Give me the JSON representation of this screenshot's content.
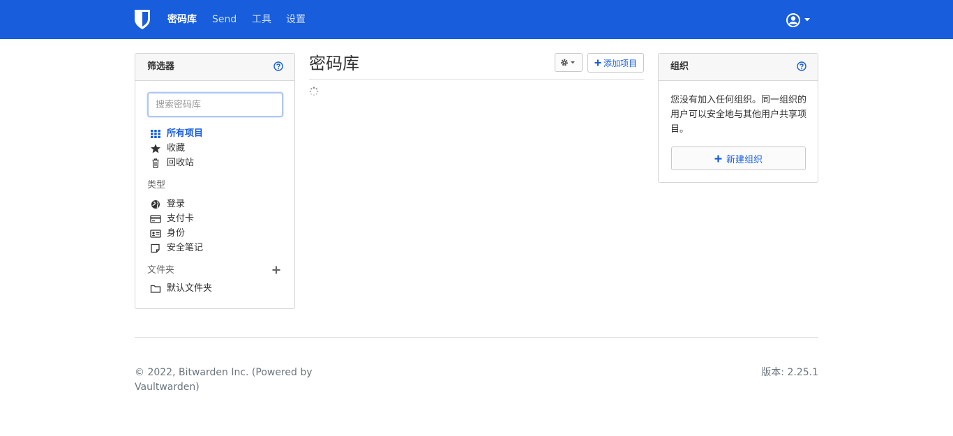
{
  "navbar": {
    "brand_icon": "bitwarden-shield-icon",
    "links": [
      {
        "label": "密码库",
        "active": true
      },
      {
        "label": "Send",
        "active": false
      },
      {
        "label": "工具",
        "active": false
      },
      {
        "label": "设置",
        "active": false
      }
    ],
    "account_icon": "user-circle-icon",
    "color": "#175ddc"
  },
  "filters": {
    "title": "筛选器",
    "search_placeholder": "搜索密码库",
    "items": [
      {
        "label": "所有项目",
        "icon": "th-grid-icon",
        "active": true
      },
      {
        "label": "收藏",
        "icon": "star-icon"
      },
      {
        "label": "回收站",
        "icon": "trash-icon"
      }
    ],
    "types_label": "类型",
    "types": [
      {
        "label": "登录",
        "icon": "globe-icon"
      },
      {
        "label": "支付卡",
        "icon": "credit-card-icon"
      },
      {
        "label": "身份",
        "icon": "id-card-icon"
      },
      {
        "label": "安全笔记",
        "icon": "sticky-note-icon"
      }
    ],
    "folders_label": "文件夹",
    "folders": [
      {
        "label": "默认文件夹",
        "icon": "folder-icon"
      }
    ]
  },
  "main": {
    "title": "密码库",
    "add_item_label": "添加项目"
  },
  "organizations": {
    "title": "组织",
    "text": "您没有加入任何组织。同一组织的用户可以安全地与其他用户共享项目。",
    "new_org_label": "新建组织"
  },
  "footer": {
    "copyright": "© 2022, Bitwarden Inc. (Powered by Vaultwarden)",
    "version": "版本: 2.25.1"
  }
}
